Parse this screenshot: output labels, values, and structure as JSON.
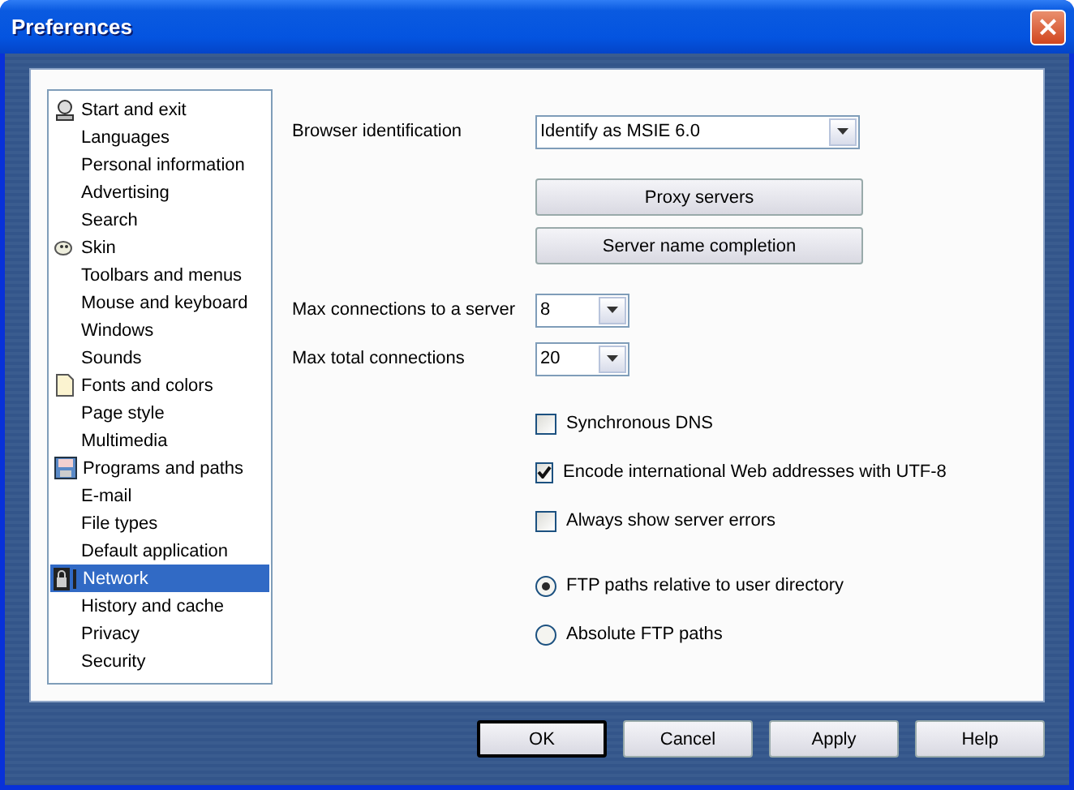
{
  "window": {
    "title": "Preferences",
    "close": "×"
  },
  "sidebar": {
    "items": [
      {
        "label": "Start and exit",
        "kind": "group",
        "selected": false
      },
      {
        "label": "Languages",
        "kind": "page",
        "selected": false
      },
      {
        "label": "Personal information",
        "kind": "page",
        "selected": false
      },
      {
        "label": "Advertising",
        "kind": "page",
        "selected": false
      },
      {
        "label": "Search",
        "kind": "page",
        "selected": false
      },
      {
        "label": "Skin",
        "kind": "group",
        "selected": false
      },
      {
        "label": "Toolbars and menus",
        "kind": "page",
        "selected": false
      },
      {
        "label": "Mouse and keyboard",
        "kind": "page",
        "selected": false
      },
      {
        "label": "Windows",
        "kind": "page",
        "selected": false
      },
      {
        "label": "Sounds",
        "kind": "page",
        "selected": false
      },
      {
        "label": "Fonts and colors",
        "kind": "group",
        "selected": false
      },
      {
        "label": "Page style",
        "kind": "page",
        "selected": false
      },
      {
        "label": "Multimedia",
        "kind": "page",
        "selected": false
      },
      {
        "label": "Programs and paths",
        "kind": "group",
        "selected": false
      },
      {
        "label": "E-mail",
        "kind": "page",
        "selected": false
      },
      {
        "label": "File types",
        "kind": "page",
        "selected": false
      },
      {
        "label": "Default application",
        "kind": "page",
        "selected": false
      },
      {
        "label": "Network",
        "kind": "group",
        "selected": true
      },
      {
        "label": "History and cache",
        "kind": "page",
        "selected": false
      },
      {
        "label": "Privacy",
        "kind": "page",
        "selected": false
      },
      {
        "label": "Security",
        "kind": "page",
        "selected": false
      }
    ]
  },
  "browser_identification": {
    "label": "Browser identification",
    "value": "Identify as MSIE 6.0"
  },
  "buttons": [
    "Proxy servers",
    "Server name completion"
  ],
  "max_connections_server": {
    "label": "Max connections to a server",
    "value": "8"
  },
  "max_total_connections": {
    "label": "Max total connections",
    "value": "20"
  },
  "checkboxes": [
    {
      "label": "Synchronous DNS",
      "checked": false
    },
    {
      "label": "Encode international Web addresses with UTF-8",
      "checked": true
    },
    {
      "label": "Always show server errors",
      "checked": false
    }
  ],
  "radios": [
    {
      "label": "FTP paths relative to user directory",
      "selected": true
    },
    {
      "label": "Absolute FTP paths",
      "selected": false
    }
  ],
  "dialog_buttons": [
    {
      "label": "OK",
      "default": true
    },
    {
      "label": "Cancel",
      "default": false
    },
    {
      "label": "Apply",
      "default": false
    },
    {
      "label": "Help",
      "default": false
    }
  ]
}
